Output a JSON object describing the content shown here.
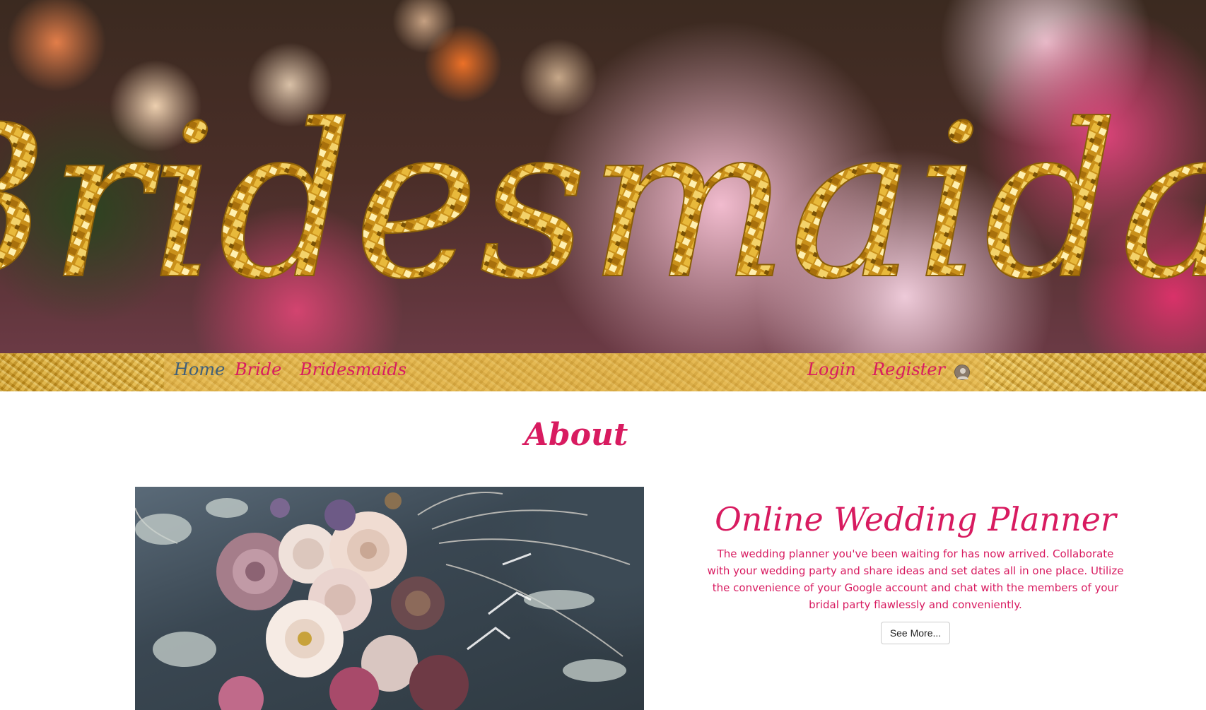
{
  "hero": {
    "title": "Bridesmaidal"
  },
  "nav": {
    "home": "Home",
    "bride": "Bride",
    "bridesmaids": "Bridesmaids",
    "login": "Login",
    "register": "Register",
    "active": "Home",
    "avatar_icon": "user-avatar-icon"
  },
  "about": {
    "heading": "About",
    "image_icon": "bouquet-photo",
    "feature_title": "Online Wedding Planner",
    "feature_text": "The wedding planner you've been waiting for has now arrived. Collaborate with your wedding party and share ideas and set dates all in one place. Utilize the convenience of your Google account and chat with the members of your bridal party flawlessly and conveniently.",
    "see_more_label": "See More..."
  },
  "colors": {
    "accent": "#d81b60",
    "active_link": "#3f5f7a",
    "gold": "#d4a030"
  }
}
